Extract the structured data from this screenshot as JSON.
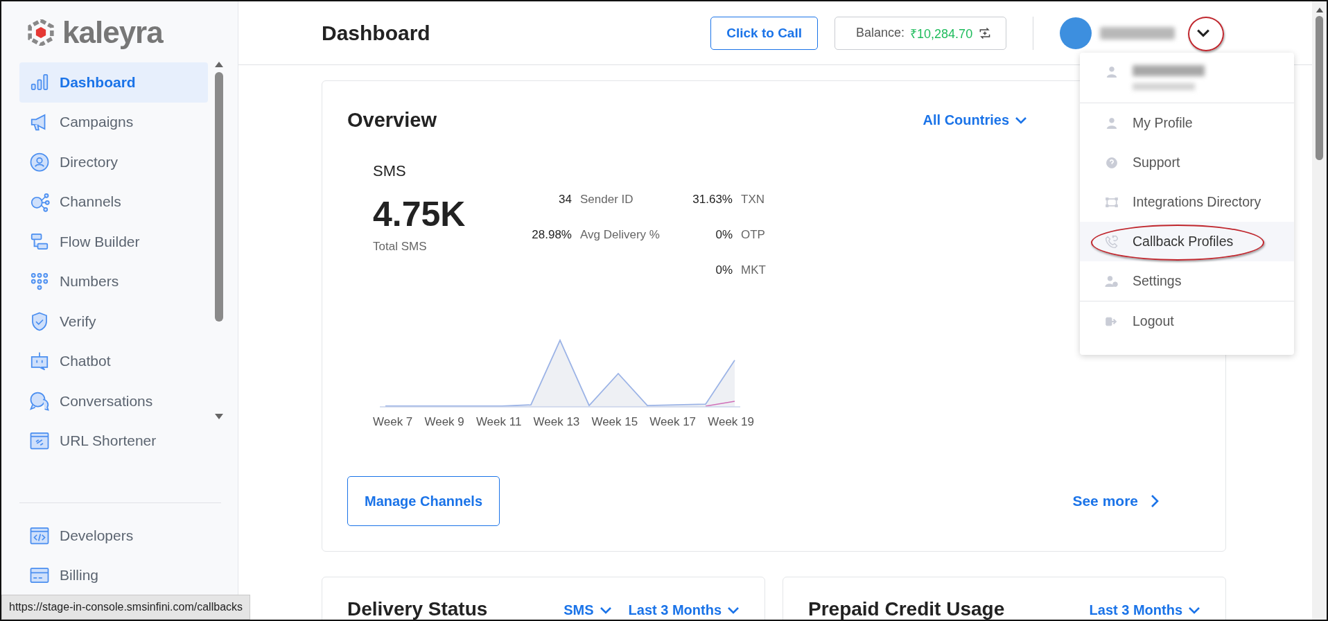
{
  "sidebar": {
    "logo": "kaleyra",
    "items": [
      {
        "label": "Dashboard",
        "selected": true
      },
      {
        "label": "Campaigns",
        "selected": false
      },
      {
        "label": "Directory",
        "selected": false
      },
      {
        "label": "Channels",
        "selected": false
      },
      {
        "label": "Flow Builder",
        "selected": false
      },
      {
        "label": "Numbers",
        "selected": false
      },
      {
        "label": "Verify",
        "selected": false
      },
      {
        "label": "Chatbot",
        "selected": false
      },
      {
        "label": "Conversations",
        "selected": false
      },
      {
        "label": "URL Shortener",
        "selected": false
      }
    ],
    "bottom_items": [
      {
        "label": "Developers",
        "selected": false
      },
      {
        "label": "Billing",
        "selected": false
      }
    ]
  },
  "header": {
    "title": "Dashboard",
    "call_button": "Click to Call",
    "balance_label": "Balance:",
    "balance_value": "₹10,284.70",
    "chevron_annotated": true
  },
  "user_menu": {
    "items": [
      {
        "label": "My Profile",
        "hovered": false,
        "annotated": false
      },
      {
        "label": "Support",
        "hovered": false,
        "annotated": false
      },
      {
        "label": "Integrations Directory",
        "hovered": false,
        "annotated": false
      },
      {
        "label": "Callback Profiles",
        "hovered": true,
        "annotated": true
      },
      {
        "label": "Settings",
        "hovered": false,
        "annotated": false
      },
      {
        "label": "Logout",
        "hovered": false,
        "annotated": false
      }
    ]
  },
  "overview": {
    "title": "Overview",
    "filter": "All Countries",
    "channel": "SMS",
    "total": "4.75K",
    "total_label": "Total SMS",
    "stats": [
      {
        "value": "34",
        "label": "Sender ID"
      },
      {
        "value": "28.98%",
        "label": "Avg Delivery %"
      }
    ],
    "mix": [
      {
        "value": "31.63%",
        "label": "TXN"
      },
      {
        "value": "0%",
        "label": "OTP"
      },
      {
        "value": "0%",
        "label": "MKT"
      }
    ],
    "chart_x_labels": [
      "Week 7",
      "Week 9",
      "Week 11",
      "Week 13",
      "Week 15",
      "Week 17",
      "Week 19"
    ],
    "manage_button": "Manage Channels",
    "see_more": "See more"
  },
  "cards": [
    {
      "title": "Delivery Status",
      "filters": [
        "SMS",
        "Last 3 Months"
      ]
    },
    {
      "title": "Prepaid Credit Usage",
      "filters": [
        "Last 3 Months"
      ]
    }
  ],
  "status_url": "https://stage-in-console.smsinfini.com/callbacks"
}
